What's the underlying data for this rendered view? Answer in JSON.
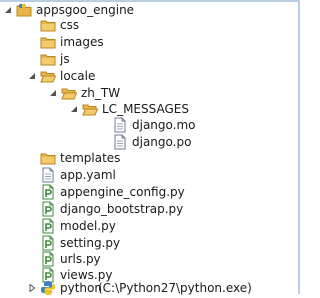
{
  "tree": {
    "project": {
      "label": "appsgoo_engine",
      "icon": "pydev-project-icon"
    },
    "folders": {
      "css": "css",
      "images": "images",
      "js": "js",
      "locale": "locale",
      "zh_tw": "zh_TW",
      "lc_messages": "LC_MESSAGES",
      "templates": "templates"
    },
    "files": {
      "django_mo": "django.mo",
      "django_po": "django.po",
      "app_yaml": "app.yaml",
      "appengine_config": "appengine_config.py",
      "django_bootstrap": "django_bootstrap.py",
      "model": "model.py",
      "setting": "setting.py",
      "urls": "urls.py",
      "views": "views.py"
    },
    "interpreter": {
      "name": "python",
      "path": "(C:\\Python27\\python.exe)"
    }
  },
  "colors": {
    "folder": "#e8b54b",
    "python_file": "#3d8a3a",
    "border": "#b9cde4"
  }
}
